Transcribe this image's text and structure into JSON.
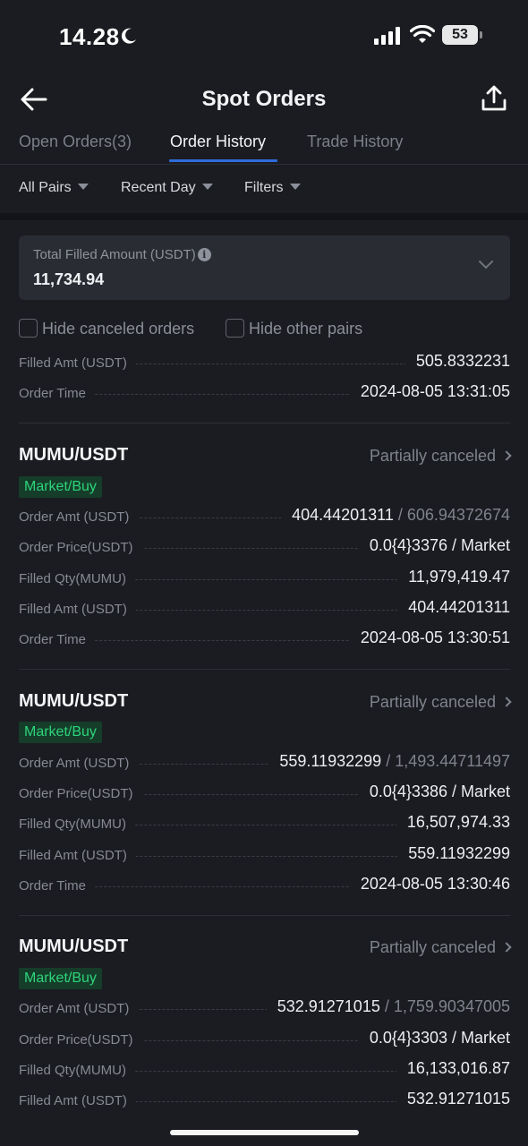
{
  "status_bar": {
    "time": "14.28",
    "battery": "53"
  },
  "header": {
    "title": "Spot Orders"
  },
  "tabs": [
    {
      "label": "Open Orders(3)"
    },
    {
      "label": "Order History"
    },
    {
      "label": "Trade History"
    }
  ],
  "filters": [
    {
      "label": "All Pairs"
    },
    {
      "label": "Recent Day"
    },
    {
      "label": "Filters"
    }
  ],
  "summary": {
    "label": "Total Filled Amount (USDT)",
    "value": "11,734.94"
  },
  "checkboxes": [
    {
      "label": "Hide canceled orders"
    },
    {
      "label": "Hide other pairs"
    }
  ],
  "partial_order": {
    "rows": [
      {
        "label": "Filled Amt (USDT)",
        "value": "505.8332231"
      },
      {
        "label": "Order Time",
        "value": "2024-08-05 13:31:05"
      }
    ]
  },
  "orders": [
    {
      "pair": "MUMU/USDT",
      "status": "Partially canceled",
      "badge": "Market/Buy",
      "rows": [
        {
          "label": "Order Amt (USDT)",
          "value": "404.44201311",
          "total": "/ 606.94372674"
        },
        {
          "label": "Order Price(USDT)",
          "value": "0.0{4}3376 / Market"
        },
        {
          "label": "Filled Qty(MUMU)",
          "value": "11,979,419.47"
        },
        {
          "label": "Filled Amt (USDT)",
          "value": "404.44201311"
        },
        {
          "label": "Order Time",
          "value": "2024-08-05 13:30:51"
        }
      ]
    },
    {
      "pair": "MUMU/USDT",
      "status": "Partially canceled",
      "badge": "Market/Buy",
      "rows": [
        {
          "label": "Order Amt (USDT)",
          "value": "559.11932299",
          "total": "/ 1,493.44711497"
        },
        {
          "label": "Order Price(USDT)",
          "value": "0.0{4}3386 / Market"
        },
        {
          "label": "Filled Qty(MUMU)",
          "value": "16,507,974.33"
        },
        {
          "label": "Filled Amt (USDT)",
          "value": "559.11932299"
        },
        {
          "label": "Order Time",
          "value": "2024-08-05 13:30:46"
        }
      ]
    },
    {
      "pair": "MUMU/USDT",
      "status": "Partially canceled",
      "badge": "Market/Buy",
      "rows": [
        {
          "label": "Order Amt (USDT)",
          "value": "532.91271015",
          "total": "/ 1,759.90347005"
        },
        {
          "label": "Order Price(USDT)",
          "value": "0.0{4}3303 / Market"
        },
        {
          "label": "Filled Qty(MUMU)",
          "value": "16,133,016.87"
        },
        {
          "label": "Filled Amt (USDT)",
          "value": "532.91271015"
        }
      ]
    }
  ]
}
